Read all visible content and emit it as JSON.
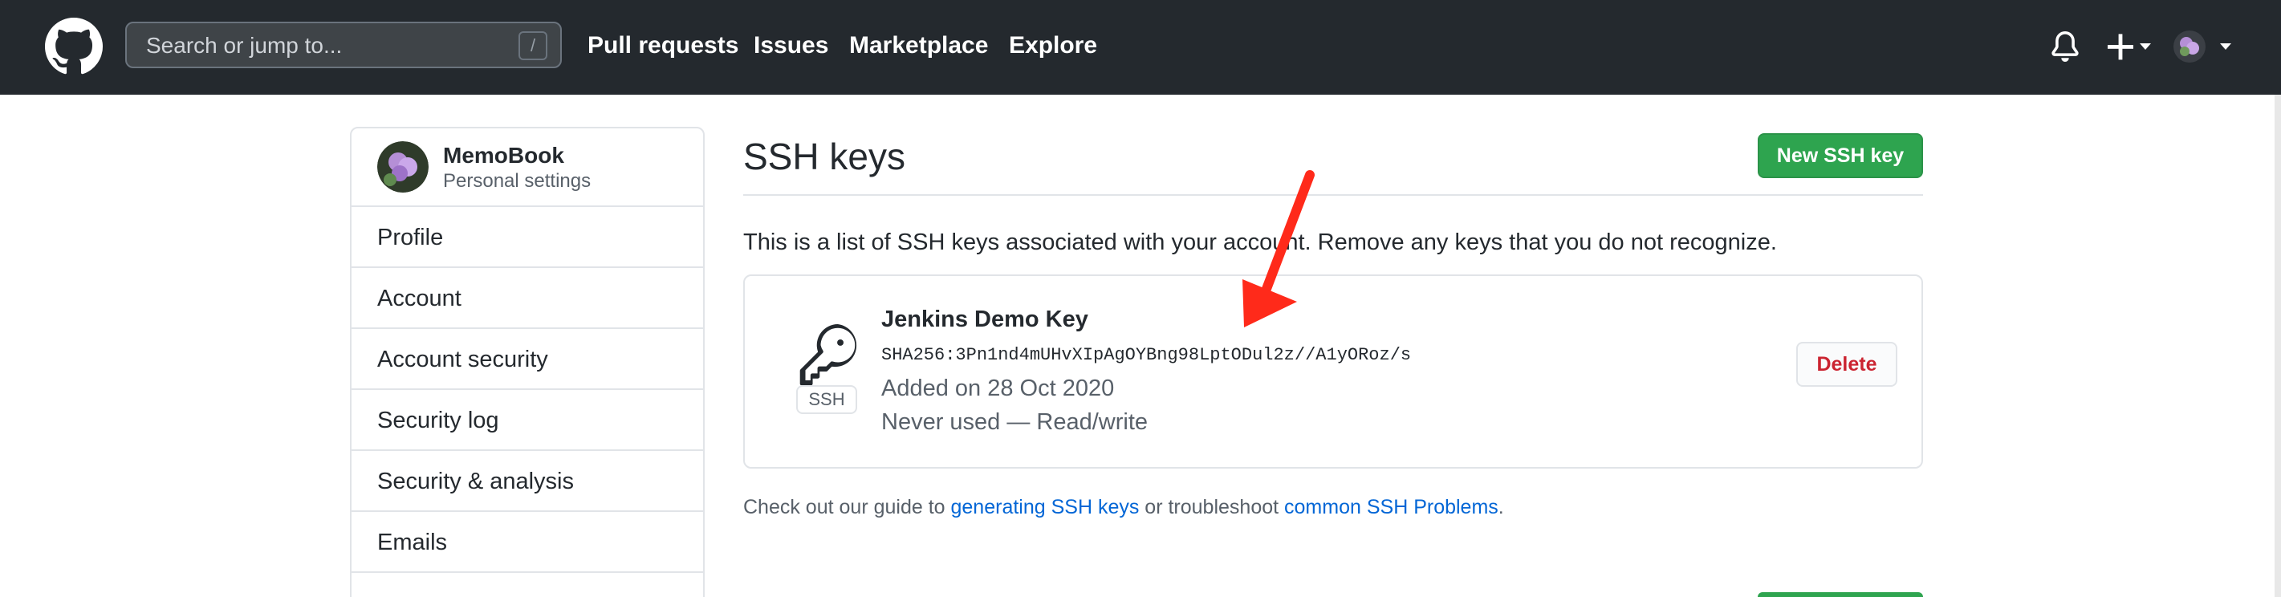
{
  "header": {
    "search_placeholder": "Search or jump to...",
    "search_shortcut": "/",
    "nav": [
      "Pull requests",
      "Issues",
      "Marketplace",
      "Explore"
    ],
    "icons": [
      "github-logo-icon",
      "bell-icon",
      "plus-icon",
      "caret-down-icon",
      "avatar"
    ]
  },
  "sidebar": {
    "user_name": "MemoBook",
    "user_subtitle": "Personal settings",
    "items": [
      {
        "label": "Profile"
      },
      {
        "label": "Account"
      },
      {
        "label": "Account security"
      },
      {
        "label": "Security log"
      },
      {
        "label": "Security & analysis"
      },
      {
        "label": "Emails"
      }
    ]
  },
  "main": {
    "title": "SSH keys",
    "new_key_button": "New SSH key",
    "intro": "This is a list of SSH keys associated with your account. Remove any keys that you do not recognize.",
    "key": {
      "badge": "SSH",
      "title": "Jenkins Demo Key",
      "fingerprint": "SHA256:3Pn1nd4mUHvXIpAgOYBng98LptODul2z//A1yORoz/s",
      "added": "Added on 28 Oct 2020",
      "usage": "Never used — Read/write",
      "delete_button": "Delete"
    },
    "guide": {
      "prefix": "Check out our guide to ",
      "link1": "generating SSH keys",
      "middle": " or troubleshoot ",
      "link2": "common SSH Problems",
      "suffix": "."
    }
  },
  "colors": {
    "header_bg": "#24292e",
    "primary_button": "#2ea44f",
    "danger_text": "#cb2431",
    "link": "#0366d6",
    "annotation_arrow": "#ff2a1a"
  }
}
